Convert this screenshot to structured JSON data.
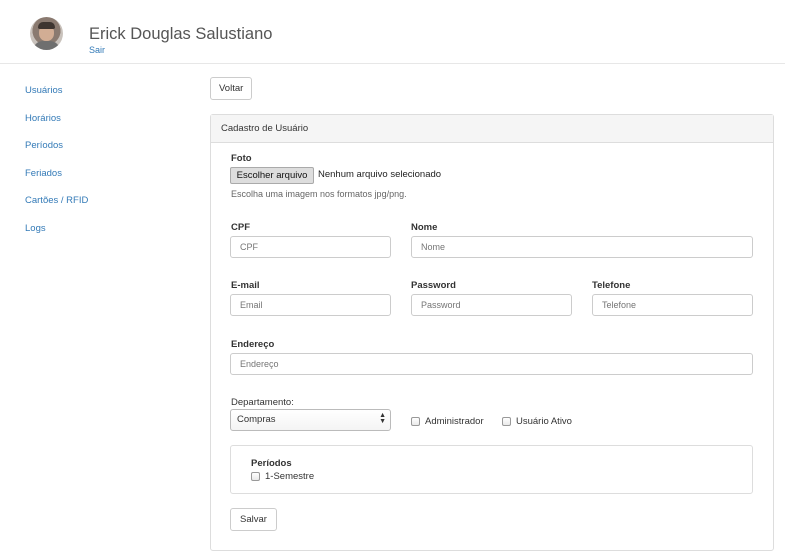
{
  "header": {
    "user_name": "Erick Douglas Salustiano",
    "logout_label": "Sair"
  },
  "sidebar": {
    "items": [
      {
        "label": "Usuários"
      },
      {
        "label": "Horários"
      },
      {
        "label": "Períodos"
      },
      {
        "label": "Feriados"
      },
      {
        "label": "Cartões / RFID"
      },
      {
        "label": "Logs"
      }
    ]
  },
  "toolbar": {
    "back_label": "Voltar"
  },
  "form": {
    "title": "Cadastro de Usuário",
    "photo": {
      "label": "Foto",
      "button_label": "Escolher arquivo",
      "status": "Nenhum arquivo selecionado",
      "help": "Escolha uma imagem nos formatos jpg/png."
    },
    "cpf": {
      "label": "CPF",
      "placeholder": "CPF",
      "value": ""
    },
    "nome": {
      "label": "Nome",
      "placeholder": "Nome",
      "value": ""
    },
    "email": {
      "label": "E-mail",
      "placeholder": "Email",
      "value": ""
    },
    "password": {
      "label": "Password",
      "placeholder": "Password",
      "value": ""
    },
    "telefone": {
      "label": "Telefone",
      "placeholder": "Telefone",
      "value": ""
    },
    "endereco": {
      "label": "Endereço",
      "placeholder": "Endereço",
      "value": ""
    },
    "departamento": {
      "label": "Departamento:",
      "selected": "Compras"
    },
    "administrador": {
      "label": "Administrador",
      "checked": false
    },
    "usuario_ativo": {
      "label": "Usuário Ativo",
      "checked": false
    },
    "periodos": {
      "title": "Períodos",
      "items": [
        {
          "label": "1-Semestre",
          "checked": false
        }
      ]
    },
    "save_label": "Salvar"
  }
}
